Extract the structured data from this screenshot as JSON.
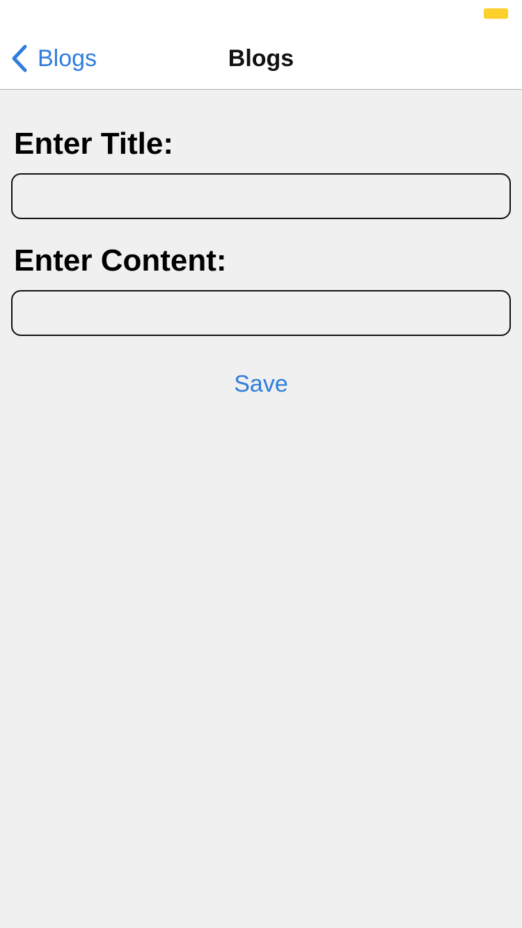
{
  "status_bar": {
    "battery_color": "#fed02c"
  },
  "nav": {
    "back_label": "Blogs",
    "back_icon": "chevron-left-icon",
    "title": "Blogs",
    "accent_color": "#2f7ddc"
  },
  "form": {
    "title_label": "Enter Title:",
    "title_value": "",
    "title_placeholder": "",
    "content_label": "Enter Content:",
    "content_value": "",
    "content_placeholder": "",
    "save_label": "Save"
  }
}
